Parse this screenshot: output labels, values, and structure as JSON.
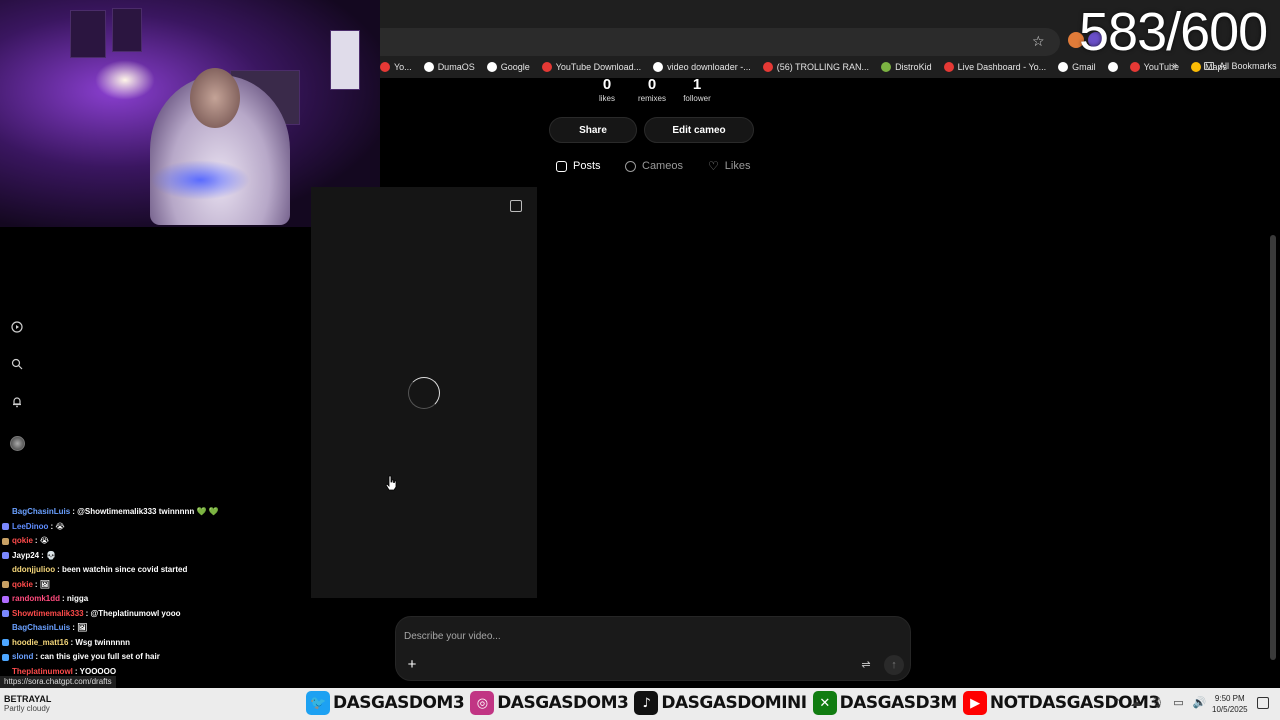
{
  "overlay": {
    "counter": "583/600"
  },
  "bookmarks": [
    {
      "label": "Yo...",
      "color": "#e53935"
    },
    {
      "label": "DumaOS",
      "color": "#ffffff"
    },
    {
      "label": "Google",
      "color": "#ffffff"
    },
    {
      "label": "YouTube Download...",
      "color": "#e53935"
    },
    {
      "label": "video downloader -...",
      "color": "#ffffff"
    },
    {
      "label": "(56) TROLLING RAN...",
      "color": "#e53935"
    },
    {
      "label": "DistroKid",
      "color": "#7cb342"
    },
    {
      "label": "Live Dashboard - Yo...",
      "color": "#e53935"
    },
    {
      "label": "Gmail",
      "color": "#ffffff"
    },
    {
      "label": "",
      "color": "#ffffff"
    },
    {
      "label": "YouTube",
      "color": "#e53935"
    },
    {
      "label": "Maps",
      "color": "#fbbc05"
    }
  ],
  "bookmarks_more": "»",
  "all_bookmarks": "All Bookmarks",
  "profile": {
    "stats": [
      {
        "num": "0",
        "label": "likes"
      },
      {
        "num": "0",
        "label": "remixes"
      },
      {
        "num": "1",
        "label": "follower"
      }
    ],
    "share_label": "Share",
    "edit_label": "Edit cameo",
    "tabs": {
      "posts": "Posts",
      "cameos": "Cameos",
      "likes": "Likes"
    }
  },
  "composer": {
    "placeholder": "Describe your video...",
    "plus": "+",
    "settings": "⇌",
    "send": "↑"
  },
  "chat": [
    {
      "user": "BagChasinLuis",
      "color": "#6aa0ff",
      "msg": ": @Showtimemalik333 twinnnnn 💚 💚",
      "badge": "#00000000"
    },
    {
      "user": "LeeDinoo",
      "color": "#5f8dff",
      "msg": ": 😭",
      "badge": "#7a88ff"
    },
    {
      "user": "qokie",
      "color": "#ff4b4b",
      "msg": ": 😭",
      "badge": "#c8a064"
    },
    {
      "user": "Jayp24",
      "color": "#ffffff",
      "msg": ": 💀",
      "badge": "#7a88ff"
    },
    {
      "user": "ddonjjulioo",
      "color": "#f5d77a",
      "msg": ": been watchin since covid started",
      "badge": "#00000000"
    },
    {
      "user": "qokie",
      "color": "#ff4b4b",
      "msg": ": 🖼",
      "badge": "#c8a064"
    },
    {
      "user": "randomk1dd",
      "color": "#ff4b7d",
      "msg": ": nigga",
      "badge": "#b06bff"
    },
    {
      "user": "Showtimemalik333",
      "color": "#ff4b4b",
      "msg": ": @Theplatinumowl yooo",
      "badge": "#7a88ff"
    },
    {
      "user": "BagChasinLuis",
      "color": "#6aa0ff",
      "msg": ": 🖼",
      "badge": "#00000000"
    },
    {
      "user": "hoodie_matt16",
      "color": "#f5d77a",
      "msg": ": Wsg twinnnnn",
      "badge": "#4da6ff"
    },
    {
      "user": "slond",
      "color": "#6aa0ff",
      "msg": ": can this give you full set of hair",
      "badge": "#4da6ff"
    },
    {
      "user": "Theplatinumowl",
      "color": "#ff4b4b",
      "msg": ": YOOOOO",
      "badge": "#00000000"
    }
  ],
  "status_url": "https://sora.chatgpt.com/drafts",
  "taskbar": {
    "weather_title": "BETRAYAL",
    "weather_sub": "Partly cloudy",
    "socials": [
      {
        "name": "DASGASDOM3",
        "icon": "twitter-bird",
        "color": "#1da1f2",
        "glyph": "🐦"
      },
      {
        "name": "DASGASDOM3",
        "icon": "instagram",
        "color": "#c13584",
        "glyph": "◎"
      },
      {
        "name": "DASGASDOMINI",
        "icon": "tiktok",
        "color": "#111111",
        "glyph": "♪"
      },
      {
        "name": "DASGASD3M",
        "icon": "xbox",
        "color": "#107c10",
        "glyph": "✕"
      },
      {
        "name": "NOTDASGASDOM3",
        "icon": "youtube",
        "color": "#ff0000",
        "glyph": "▶"
      }
    ],
    "time": "9:50 PM",
    "date": "10/5/2025"
  }
}
